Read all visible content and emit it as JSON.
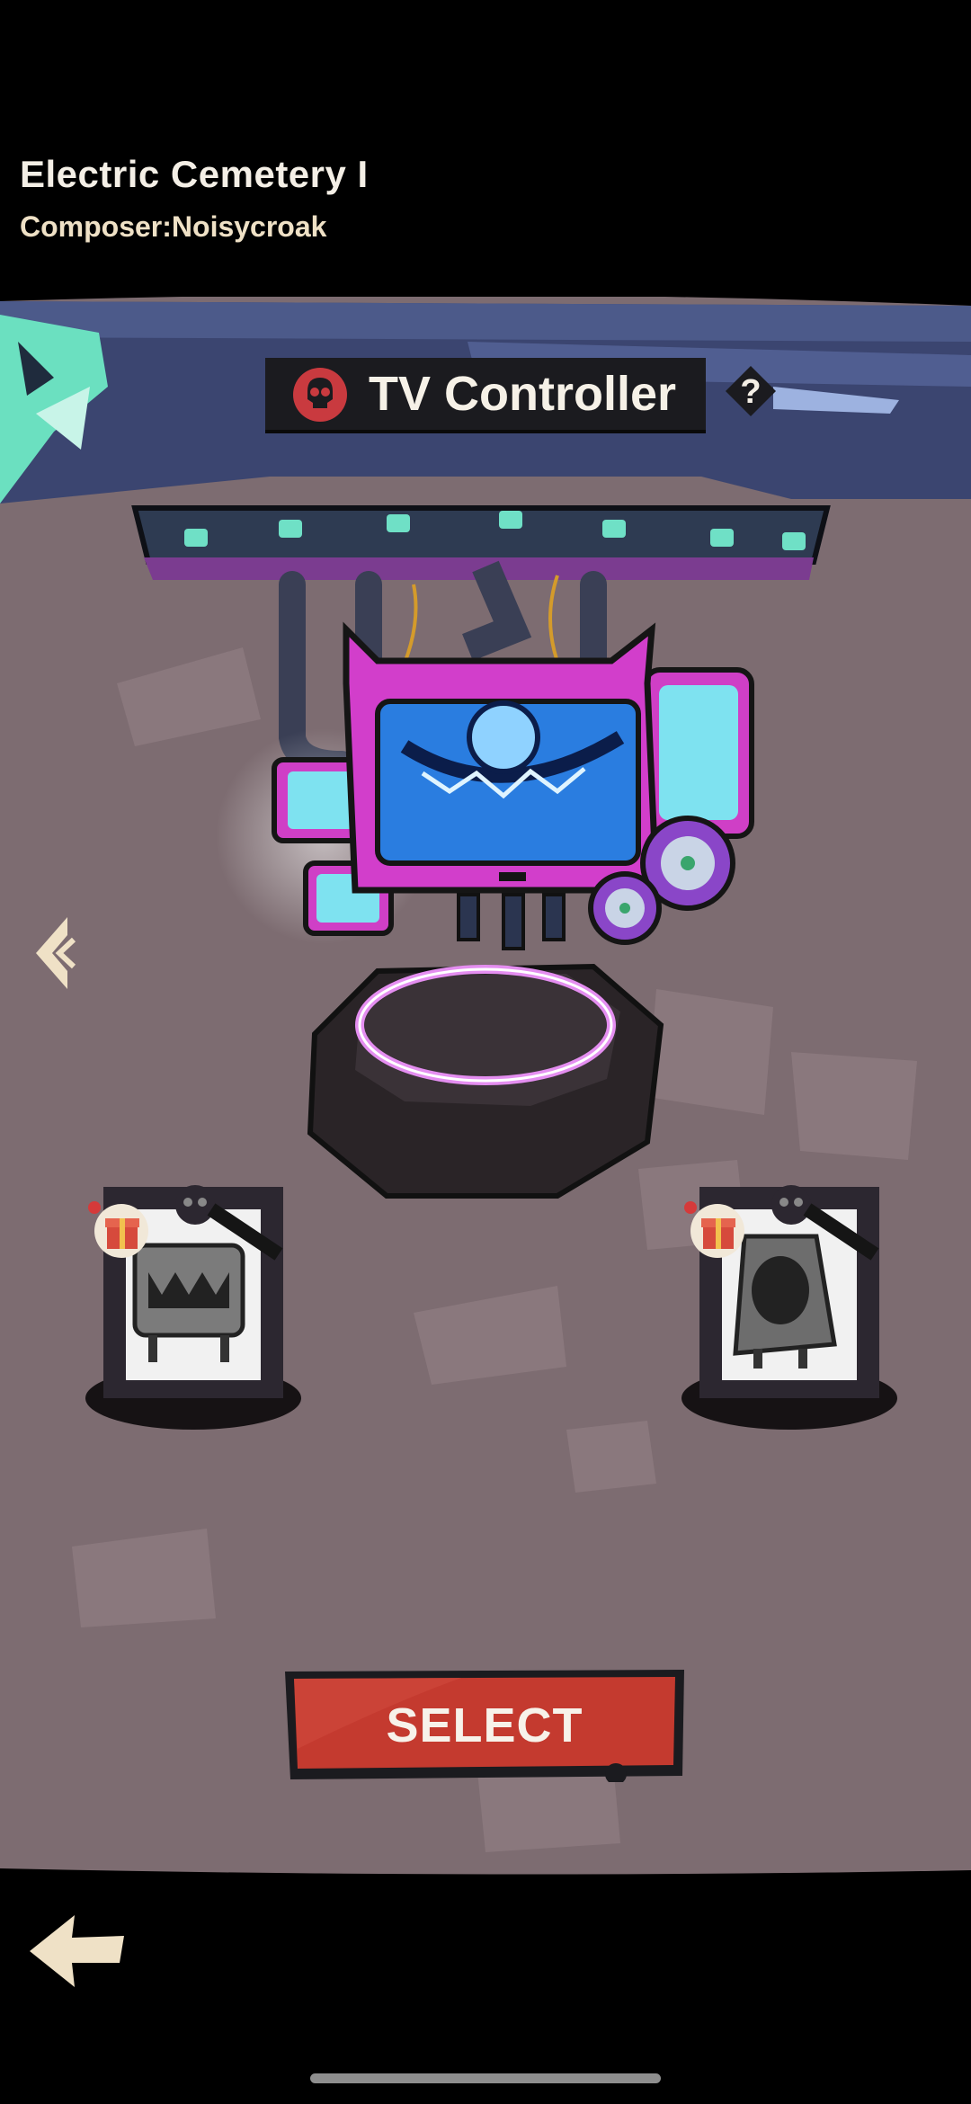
{
  "song": {
    "title": "Electric Cemetery I",
    "composer": "Composer:Noisycroak"
  },
  "boss": {
    "name": "TV Controller",
    "icon": "skull-icon",
    "help_icon": "question-icon"
  },
  "characters": [
    {
      "name": "tv-monster",
      "locked": true,
      "reward_icon": "gift-icon"
    },
    {
      "name": "speaker-monster",
      "locked": true,
      "reward_icon": "gift-icon"
    }
  ],
  "actions": {
    "select_label": "SELECT",
    "prev_icon": "chevron-left-icon",
    "back_icon": "back-arrow-icon"
  },
  "colors": {
    "stage_bg": "#7d6c71",
    "button_red": "#c43a2f",
    "banner_dark": "#1b1b1f",
    "accent_magenta": "#d83ed0"
  }
}
